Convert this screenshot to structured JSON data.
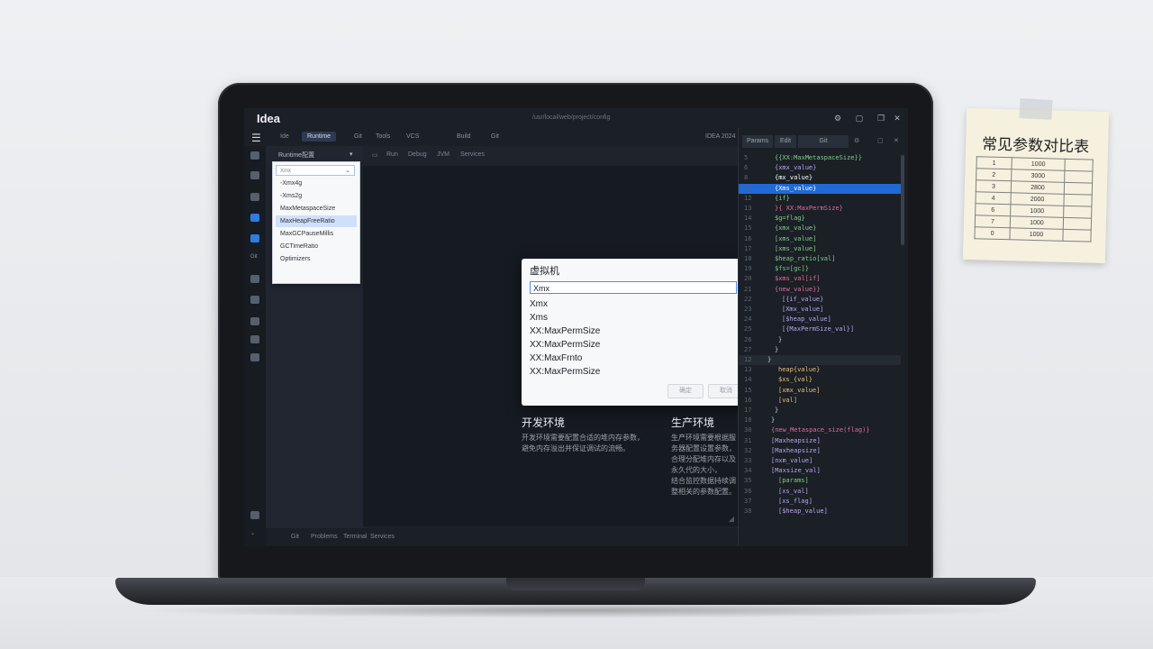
{
  "app": {
    "title": "Idea",
    "path": "/usr/local/web/project/config"
  },
  "menu": {
    "items": [
      "Ide",
      "Runtime",
      "Git",
      "Tools",
      "VCS",
      "Build",
      "Git"
    ],
    "active_index": 1,
    "right_label": "IDEA 2024"
  },
  "left_panel": {
    "header": "Runtime配置",
    "dropdown_value": "Xmx",
    "items": [
      "-Xmx4g",
      "-Xms2g",
      "MaxMetaspaceSize",
      "MaxHeapFreeRatio",
      "MaxGCPauseMillis",
      "GCTimeRatio",
      "Optimizers"
    ],
    "selected_index": 3
  },
  "subbar": {
    "items": [
      "Run",
      "Debug",
      "JVM",
      "Services"
    ]
  },
  "status_bar": {
    "items": [
      "Git",
      "Problems",
      "Terminal",
      "Services"
    ]
  },
  "dialog": {
    "title": "虚拟机",
    "input_value": "Xmx",
    "options": [
      "Xmx",
      "Xms",
      "XX:MaxPermSize",
      "XX:MaxPermSize",
      "XX:MaxFrnto",
      "XX:MaxPermSize"
    ],
    "confirm_label": "确定",
    "cancel_label": "取消"
  },
  "sections": [
    {
      "title": "开发环境",
      "text": [
        "开发环境需要配置合适的堆内存参数，",
        "避免内存溢出并保证调试的流畅。"
      ]
    },
    {
      "title": "生产环境",
      "text": [
        "生产环境需要根据服务器配置设置参数，",
        "合理分配堆内存以及永久代的大小，",
        "结合监控数据持续调整相关的参数配置。"
      ]
    }
  ],
  "right_panel": {
    "tabs": [
      "Params",
      "Edit",
      "Git"
    ],
    "highlighted_line": 3,
    "lines": [
      {
        "n": "5",
        "t": "{{XX:MaxMetaspaceSize}}",
        "c": "#7fd18c",
        "i": 3
      },
      {
        "n": "6",
        "t": "{xmx_value}",
        "c": "#b7a7f0",
        "i": 3
      },
      {
        "n": "8",
        "t": "{mx_value}",
        "c": "#ffffff",
        "i": 3
      },
      {
        "n": "11",
        "t": "{Xms_value}",
        "c": "#7fd18c",
        "i": 3
      },
      {
        "n": "12",
        "t": "{if}",
        "c": "#7fd18c",
        "i": 3
      },
      {
        "n": "13",
        "t": "}{ XX:MaxPermSize}",
        "c": "#e06c9f",
        "i": 3
      },
      {
        "n": "14",
        "t": "$g=flag}",
        "c": "#7fd18c",
        "i": 3
      },
      {
        "n": "15",
        "t": "{xmx_value}",
        "c": "#7fd18c",
        "i": 3
      },
      {
        "n": "16",
        "t": "[xms_value]",
        "c": "#7fd18c",
        "i": 3
      },
      {
        "n": "17",
        "t": "[xms_value]",
        "c": "#7fd18c",
        "i": 3
      },
      {
        "n": "18",
        "t": "$heap_ratio[val]",
        "c": "#7fd18c",
        "i": 3
      },
      {
        "n": "19",
        "t": "$fs=[gc]}",
        "c": "#7fd18c",
        "i": 3
      },
      {
        "n": "20",
        "t": "$xms_val[if]",
        "c": "#e06c9f",
        "i": 3
      },
      {
        "n": "21",
        "t": "{new_value}}",
        "c": "#e06c9f",
        "i": 3
      },
      {
        "n": "22",
        "t": "[{if_value}",
        "c": "#b7a7f0",
        "i": 5
      },
      {
        "n": "23",
        "t": "[Xmx_value]",
        "c": "#b7a7f0",
        "i": 5
      },
      {
        "n": "24",
        "t": "[$heap_value]",
        "c": "#b7a7f0",
        "i": 5
      },
      {
        "n": "25",
        "t": "[{MaxPermSize_val}]",
        "c": "#b7a7f0",
        "i": 5
      },
      {
        "n": "26",
        "t": "}",
        "c": "#c7ccd5",
        "i": 4
      },
      {
        "n": "27",
        "t": "}",
        "c": "#c7ccd5",
        "i": 3
      },
      {
        "n": "12",
        "t": "}",
        "c": "#c7ccd5",
        "i": 1
      },
      {
        "n": "13",
        "t": "heap{value}",
        "c": "#e5c07b",
        "i": 4
      },
      {
        "n": "14",
        "t": "$xs_{val}",
        "c": "#e5c07b",
        "i": 4
      },
      {
        "n": "15",
        "t": "[xmx_value]",
        "c": "#e5c07b",
        "i": 4
      },
      {
        "n": "16",
        "t": "[val]",
        "c": "#e5c07b",
        "i": 4
      },
      {
        "n": "17",
        "t": "}",
        "c": "#c7ccd5",
        "i": 3
      },
      {
        "n": "18",
        "t": "}",
        "c": "#c7ccd5",
        "i": 2
      },
      {
        "n": "30",
        "t": "{new_Metaspace_size(flag)}",
        "c": "#e06c9f",
        "i": 2
      },
      {
        "n": "31",
        "t": "[Maxheapsize]",
        "c": "#b7a7f0",
        "i": 2
      },
      {
        "n": "32",
        "t": "[Maxheapsize]",
        "c": "#b7a7f0",
        "i": 2
      },
      {
        "n": "33",
        "t": "[nxm_value]",
        "c": "#b7a7f0",
        "i": 2
      },
      {
        "n": "34",
        "t": "[Maxsize_val]",
        "c": "#b7a7f0",
        "i": 2
      },
      {
        "n": "35",
        "t": "[params]",
        "c": "#7fd18c",
        "i": 4
      },
      {
        "n": "36",
        "t": "[xs_val]",
        "c": "#b7a7f0",
        "i": 4
      },
      {
        "n": "37",
        "t": "[xs_flag]",
        "c": "#b7a7f0",
        "i": 4
      },
      {
        "n": "38",
        "t": "[$heap_value]",
        "c": "#b7a7f0",
        "i": 4
      }
    ]
  },
  "note": {
    "title": "常见参数对比表",
    "rows": [
      [
        "1",
        "1000",
        ""
      ],
      [
        "2",
        "3000",
        ""
      ],
      [
        "3",
        "2800",
        ""
      ],
      [
        "4",
        "2000",
        ""
      ],
      [
        "6",
        "1000",
        ""
      ],
      [
        "7",
        "1000",
        ""
      ],
      [
        "0",
        "1000",
        ""
      ]
    ]
  }
}
